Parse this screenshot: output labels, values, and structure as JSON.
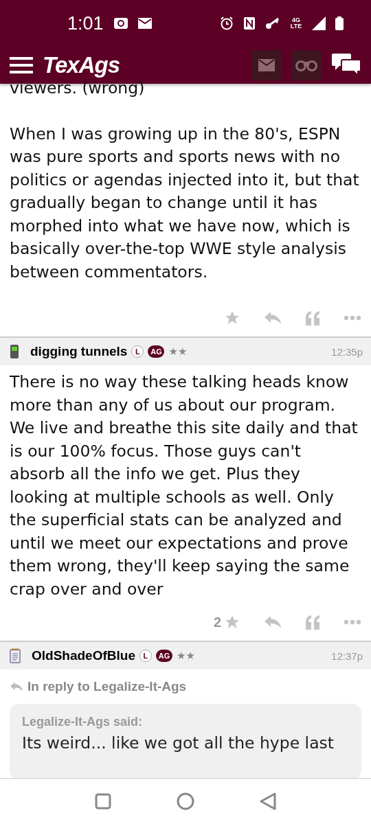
{
  "status_bar": {
    "time": "1:01",
    "network": "4G LTE"
  },
  "header": {
    "logo": "TexAgs"
  },
  "posts": [
    {
      "kind": "continued",
      "paragraphs": [
        "viewers. (wrong)",
        "When I was growing up in the 80's, ESPN was pure sports and sports news with no politics or agendas injected into it, but that gradually began to change until it has morphed into what we have now, which is basically over-the-top WWE style analysis between commentators."
      ],
      "actions": {
        "starred": false
      }
    },
    {
      "kind": "post",
      "username": "digging tunnels",
      "badges": [
        "L",
        "AG"
      ],
      "rank": "★★",
      "time": "12:35p",
      "paragraphs": [
        "There is no way these talking heads know more than any of us about our program. We live and breathe this site daily and that is our 100% focus. Those guys can't absorb all the info we get. Plus they looking at multiple schools as well. Only the superficial stats can be analyzed and until we meet our expectations and prove them wrong, they'll keep saying the same crap over and over"
      ],
      "actions": {
        "starred": false,
        "star_count": "2"
      }
    },
    {
      "kind": "post",
      "username": "OldShadeOfBlue",
      "badges": [
        "L",
        "AG"
      ],
      "rank": "★★",
      "time": "12:37p",
      "reply_to": "In reply to Legalize-It-Ags",
      "quote": {
        "author": "Legalize-It-Ags said:",
        "text": "Its weird... like we got all the hype last"
      }
    }
  ]
}
